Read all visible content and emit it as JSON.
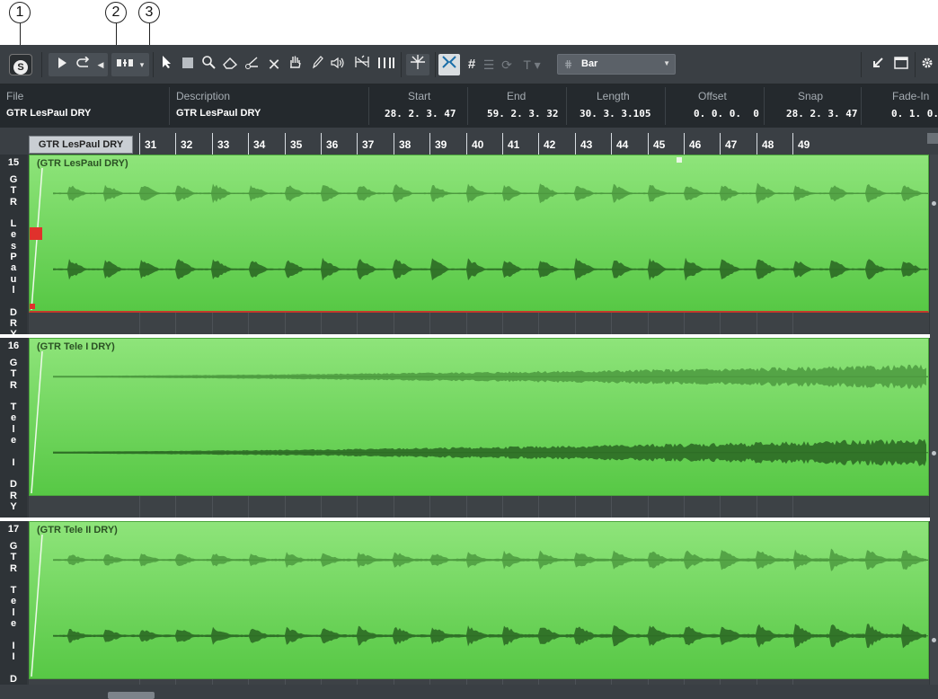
{
  "callouts": [
    "1",
    "2",
    "3"
  ],
  "toolbar": {
    "solo_label": "S",
    "play_icon": "play-icon",
    "loop_icon": "loop-icon",
    "tools": [
      "pointer-icon",
      "range-icon",
      "zoom-icon",
      "erase-icon",
      "split-icon",
      "mute-icon",
      "hand-icon",
      "draw-icon",
      "speaker-icon",
      "timewarp-icon",
      "bars-icon"
    ],
    "quantize_label": "Bar",
    "right_icons": [
      "collapse-icon",
      "window-icon",
      "settings-icon"
    ]
  },
  "infoline": {
    "columns": [
      {
        "header": "File",
        "value": "GTR LesPaul DRY"
      },
      {
        "header": "Description",
        "value": "GTR LesPaul DRY"
      },
      {
        "header": "Start",
        "value": "28. 2. 3. 47"
      },
      {
        "header": "End",
        "value": "59. 2. 3. 32"
      },
      {
        "header": "Length",
        "value": "30. 3. 3.105"
      },
      {
        "header": "Offset",
        "value": "0. 0. 0.  0"
      },
      {
        "header": "Snap",
        "value": "28. 2. 3. 47"
      },
      {
        "header": "Fade-In",
        "value": "0. 1. 0."
      }
    ]
  },
  "ruler": {
    "tab_label": "GTR LesPaul DRY",
    "bars": [
      "31",
      "32",
      "33",
      "34",
      "35",
      "36",
      "37",
      "38",
      "39",
      "40",
      "41",
      "42",
      "43",
      "44",
      "45",
      "46",
      "47",
      "48",
      "49"
    ]
  },
  "tracks": [
    {
      "number": "15",
      "vertical_label": "G\nT\nR\n \nL\ne\ns\nP\na\nu\nl\n \nD\nR\nY",
      "event_title": "(GTR LesPaul DRY)",
      "color": "#57c845"
    },
    {
      "number": "16",
      "vertical_label": "G\nT\nR\n \nT\ne\nl\ne\n \nI\n \nD\nR\nY",
      "event_title": "(GTR Tele I DRY)",
      "color": "#57c845"
    },
    {
      "number": "17",
      "vertical_label": "G\nT\nR\n \nT\ne\nl\ne\n \nI\nI\n \nD",
      "event_title": "(GTR Tele II DRY)",
      "color": "#57c845"
    }
  ]
}
